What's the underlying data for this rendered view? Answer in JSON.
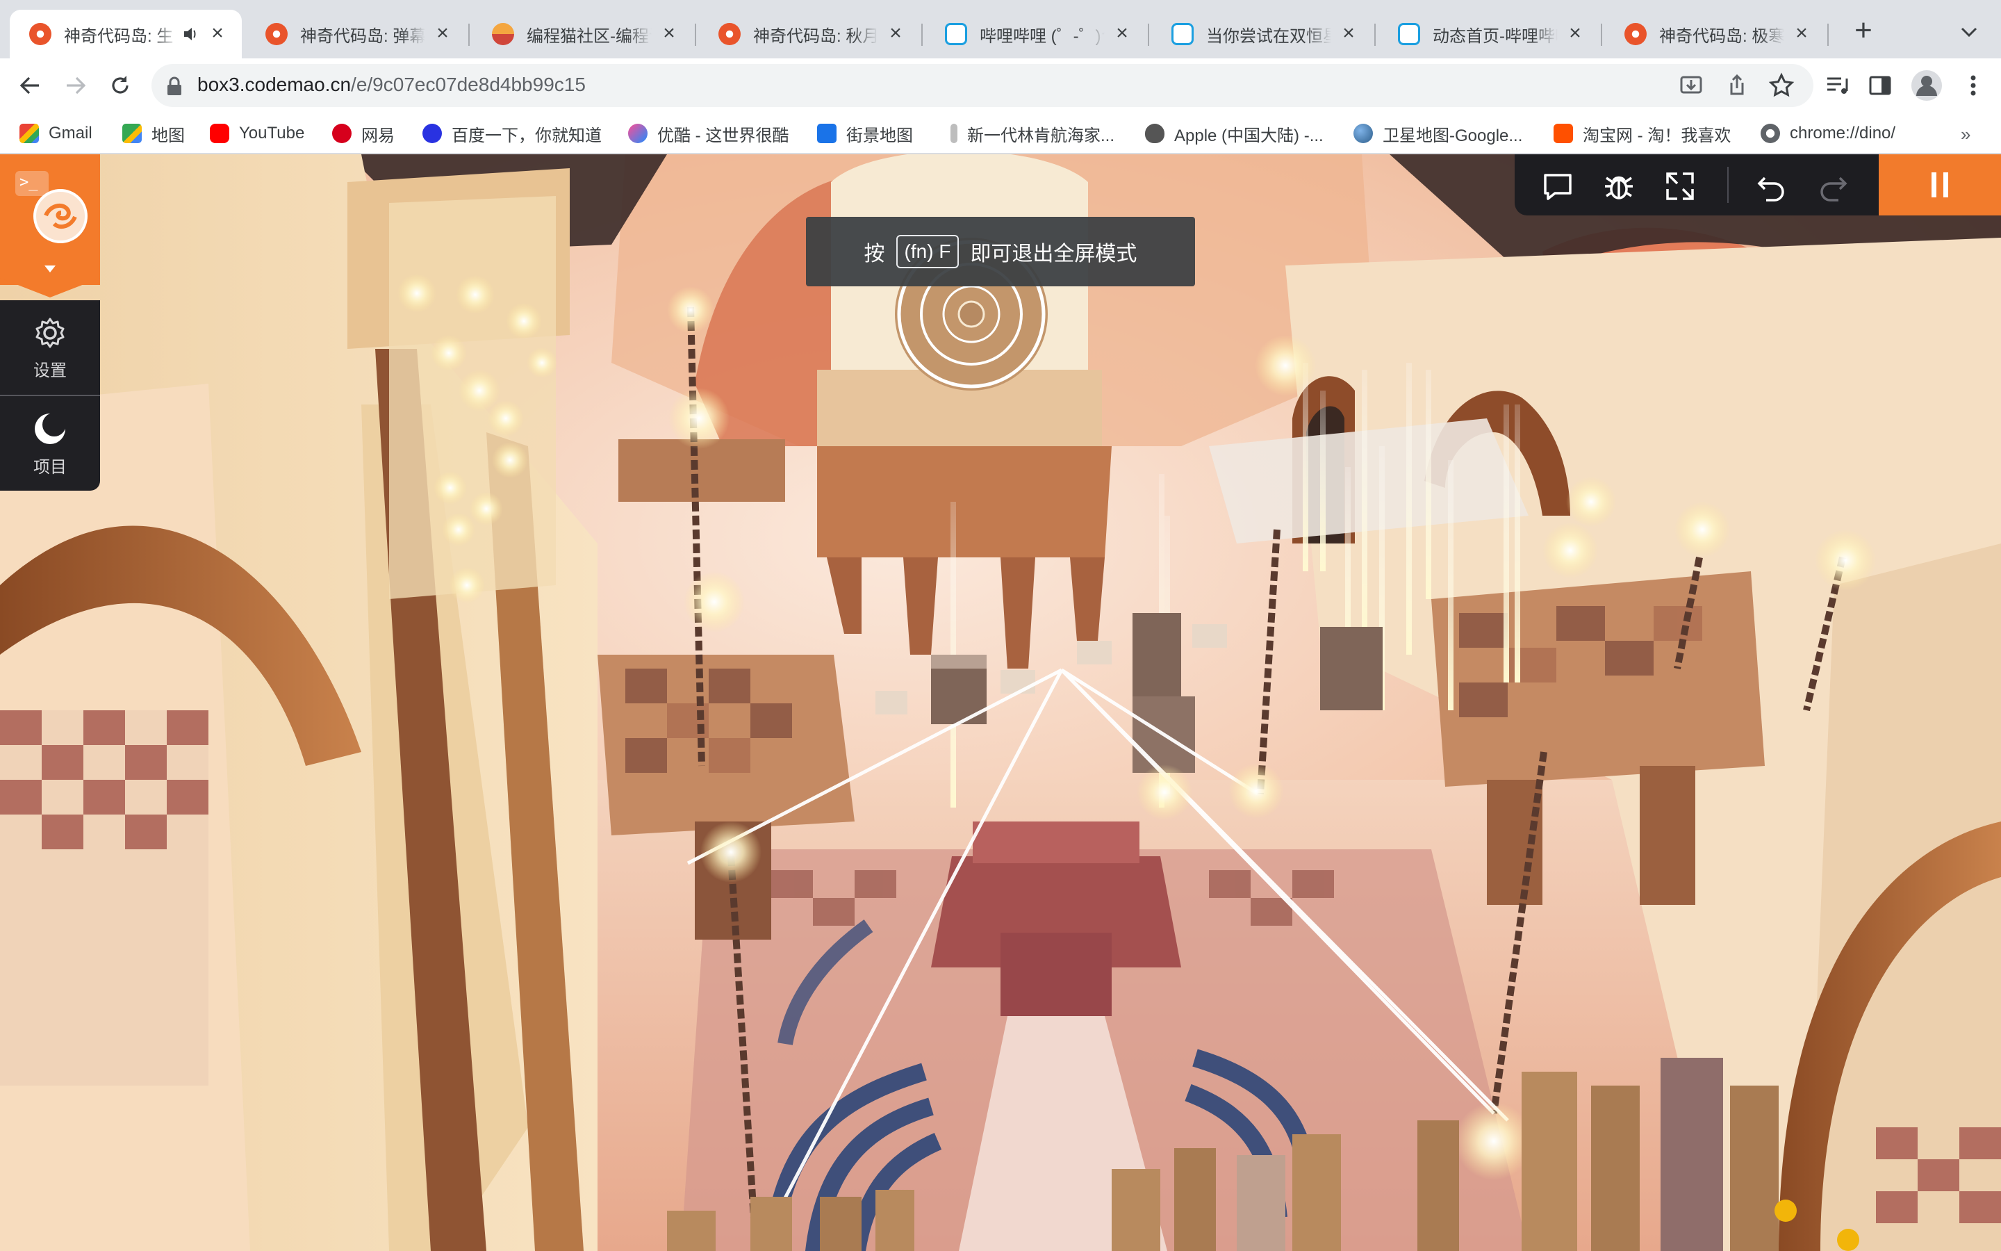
{
  "browser": {
    "tabs": [
      {
        "title": "神奇代码岛: 生",
        "favicon": "codemao-icon",
        "active": true,
        "audio": true
      },
      {
        "title": "神奇代码岛: 弹幕游",
        "favicon": "codemao-icon"
      },
      {
        "title": "编程猫社区-编程论",
        "favicon": "codemao-cat-icon"
      },
      {
        "title": "神奇代码岛: 秋月傳",
        "favicon": "codemao-icon"
      },
      {
        "title": "哔哩哔哩 (゜-゜)つ",
        "favicon": "bilibili-icon"
      },
      {
        "title": "当你尝试在双恒星",
        "favicon": "bilibili-icon"
      },
      {
        "title": "动态首页-哔哩哔哩",
        "favicon": "bilibili-icon"
      },
      {
        "title": "神奇代码岛: 极寒之",
        "favicon": "codemao-icon"
      }
    ],
    "address": {
      "host": "box3.codemao.cn",
      "path": "/e/9c07ec07de8d4bb99c15"
    },
    "bookmarks": [
      {
        "label": "Gmail",
        "icon": "gmail-icon"
      },
      {
        "label": "地图",
        "icon": "maps-icon"
      },
      {
        "label": "YouTube",
        "icon": "youtube-icon"
      },
      {
        "label": "网易",
        "icon": "netease-icon"
      },
      {
        "label": "百度一下，你就知道",
        "icon": "baidu-icon"
      },
      {
        "label": "优酷 - 这世界很酷",
        "icon": "youku-icon"
      },
      {
        "label": "街景地图",
        "icon": "streetview-icon"
      },
      {
        "label": "新一代林肯航海家...",
        "icon": "lincoln-icon"
      },
      {
        "label": "Apple (中国大陆) -...",
        "icon": "apple-icon"
      },
      {
        "label": "卫星地图-Google...",
        "icon": "earth-icon"
      },
      {
        "label": "淘宝网 - 淘！我喜欢",
        "icon": "taobao-icon"
      },
      {
        "label": "chrome://dino/",
        "icon": "globe-icon"
      }
    ],
    "bookmarks_more": "»"
  },
  "fullscreen_hint": {
    "prefix": "按",
    "key": "(fn) F",
    "suffix": "即可退出全屏模式"
  },
  "editor": {
    "terminal_glyph": ">_",
    "menu": [
      {
        "label": "设置",
        "icon": "gear-icon"
      },
      {
        "label": "项目",
        "icon": "moon-icon"
      }
    ]
  },
  "controls": [
    "comment-icon",
    "bug-icon",
    "fullscreen-icon",
    "undo-icon",
    "redo-icon",
    "pause-icon"
  ],
  "colors": {
    "accent": "#f27b2c",
    "panel_dark": "#1d1d21",
    "tab_bg": "#dee1e6"
  }
}
